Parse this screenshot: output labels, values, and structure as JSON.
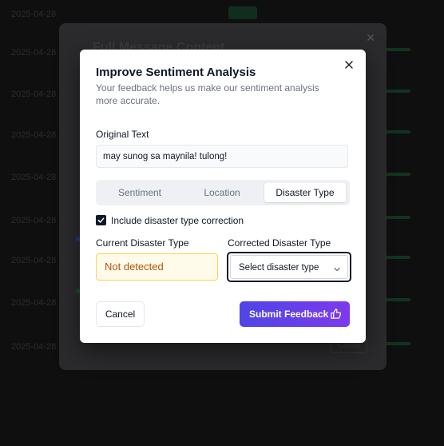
{
  "dialog": {
    "title": "Improve Sentiment Analysis",
    "subtitle": "Your feedback helps us make our sentiment analysis more accurate.",
    "original_text_label": "Original Text",
    "original_text_value": "may sunog sa maynila! tulong!",
    "tabs": [
      {
        "label": "Sentiment",
        "active": false
      },
      {
        "label": "Location",
        "active": false
      },
      {
        "label": "Disaster Type",
        "active": true
      }
    ],
    "checkbox": {
      "label": "Include disaster type correction",
      "checked": true
    },
    "current_label": "Current Disaster Type",
    "current_value": "Not detected",
    "corrected_label": "Corrected Disaster Type",
    "select_placeholder": "Select disaster type",
    "cancel_label": "Cancel",
    "submit_label": "Submit Feedback",
    "close_icon": "close-icon",
    "submit_icon": "thumbs-up-icon"
  },
  "background": {
    "modal_title": "Full Message Content",
    "close_label": "Close",
    "dates": [
      "2025-04-28",
      "2025-04-28",
      "2025-04-28",
      "2025-04-28",
      "2025-04-28",
      "2025-04-28",
      "2025-04-28",
      "2025-04-28",
      "2025-04-28"
    ]
  },
  "colors": {
    "accent_start": "#4f46e5",
    "accent_end": "#7c3aed",
    "warning_bg": "#fffbeb",
    "warning_border": "#fcd34d",
    "warning_text": "#b45309"
  }
}
